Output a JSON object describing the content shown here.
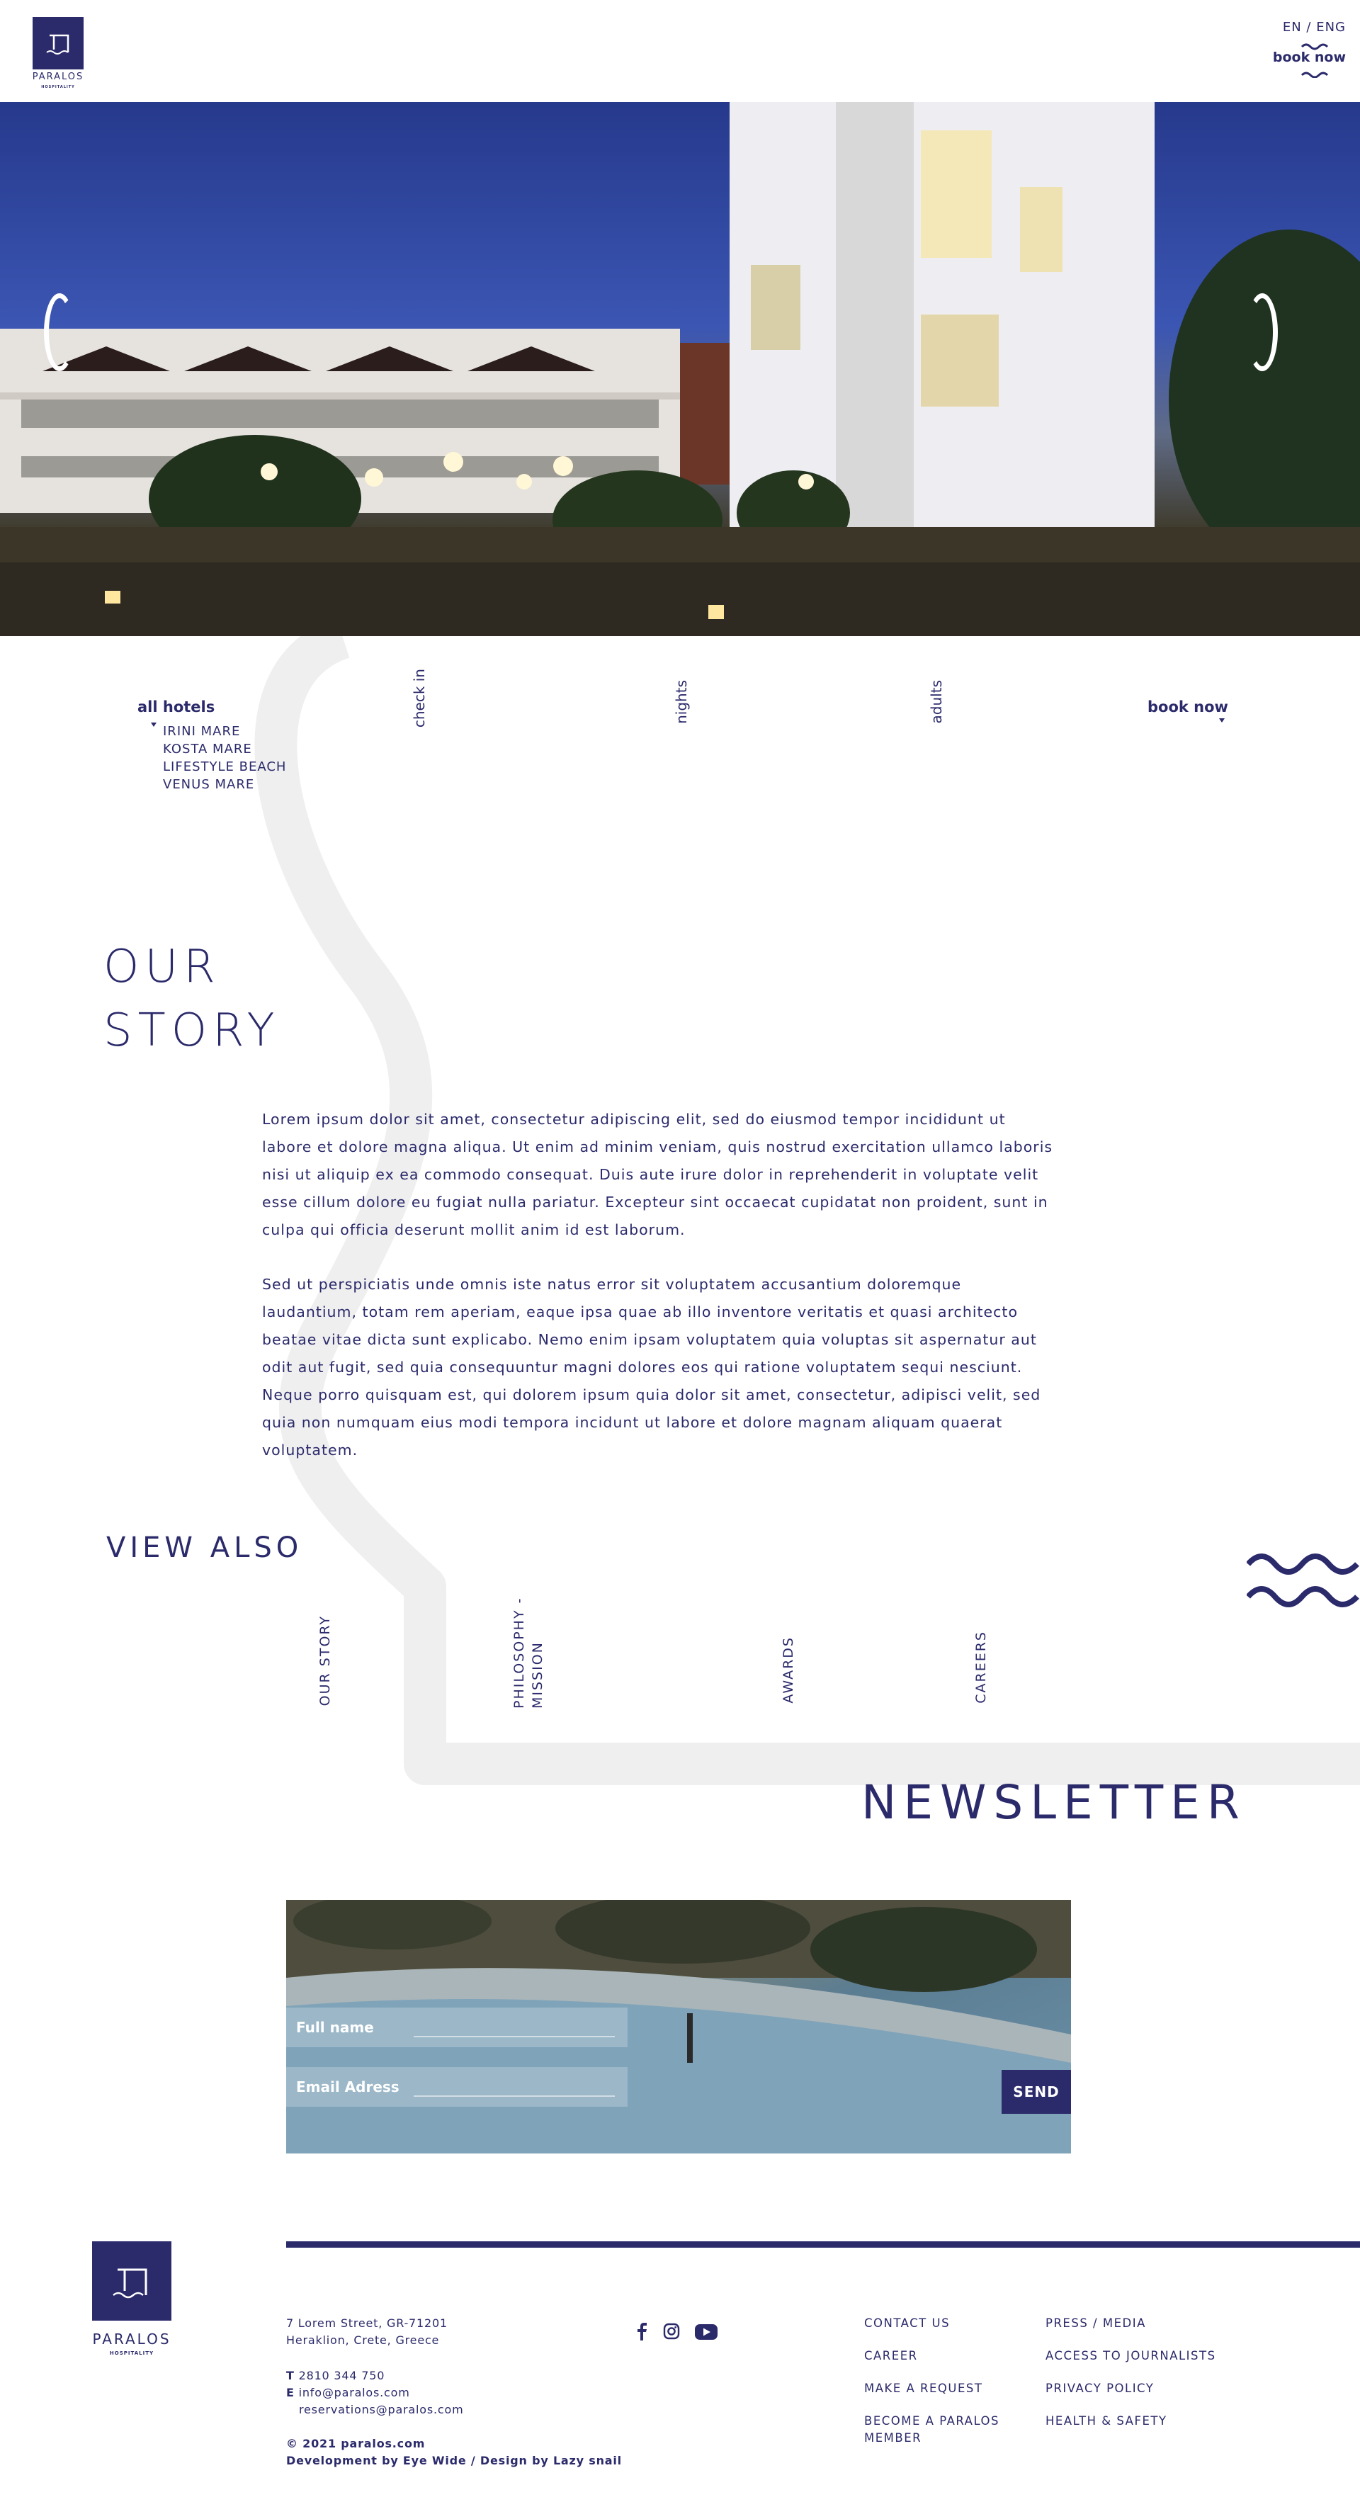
{
  "header": {
    "brand_name": "PARALOS",
    "brand_sub": "HOSPITALITY",
    "language": "EN / ENG",
    "book_now": "book now"
  },
  "hero": {
    "prev_icon": "bracket-left-icon",
    "next_icon": "bracket-right-icon"
  },
  "booking_bar": {
    "hotels_label": "all hotels",
    "hotels": [
      "IRINI MARE",
      "KOSTA MARE",
      "LIFESTYLE BEACH",
      "VENUS MARE"
    ],
    "check_in": "check in",
    "nights": "nights",
    "adults": "adults",
    "book_now": "book now"
  },
  "story": {
    "title_line1": "OUR",
    "title_line2": "STORY",
    "paragraph1_lines": [
      "Lorem ipsum dolor sit amet, consectetur adipiscing elit, sed do eiusmod tempor incididunt ut",
      "labore et dolore magna aliqua. Ut enim ad minim veniam, quis nostrud exercitation ullamco laboris",
      "nisi ut aliquip ex ea commodo consequat. Duis aute irure dolor in reprehenderit in voluptate velit",
      "esse cillum dolore eu fugiat nulla pariatur. Excepteur sint occaecat cupidatat non proident, sunt in",
      "culpa qui officia deserunt mollit anim id est laborum."
    ],
    "paragraph2_lines": [
      "Sed ut perspiciatis unde omnis iste natus error sit voluptatem accusantium doloremque",
      "laudantium, totam rem aperiam, eaque ipsa quae ab illo inventore veritatis et quasi architecto",
      "beatae vitae dicta sunt explicabo. Nemo enim ipsam voluptatem quia voluptas sit aspernatur aut",
      "odit aut fugit, sed quia consequuntur magni dolores eos qui ratione voluptatem sequi nesciunt.",
      "Neque porro quisquam est, qui dolorem ipsum quia dolor sit amet, consectetur, adipisci velit, sed",
      "quia non numquam eius modi tempora incidunt ut labore et dolore magnam aliquam quaerat",
      "voluptatem."
    ]
  },
  "view_also": {
    "title": "VIEW ALSO",
    "links": [
      "OUR STORY",
      "PHILOSOPHY - MISSION",
      "AWARDS",
      "CAREERS"
    ]
  },
  "newsletter": {
    "title": "NEWSLETTER",
    "full_name_label": "Full name",
    "email_label": "Email Adress",
    "send_label": "SEND"
  },
  "footer": {
    "brand_name": "PARALOS",
    "brand_sub": "HOSPITALITY",
    "address_line1": "7 Lorem Street, GR-71201",
    "address_line2": "Heraklion, Crete, Greece",
    "phone_prefix": "T",
    "phone": "2810 344 750",
    "email_prefix": "E",
    "email1": "info@paralos.com",
    "email2": "reservations@paralos.com",
    "copyright": "© 2021 paralos.com",
    "credits": "Development by Eye Wide / Design by Lazy snail",
    "social_icons": [
      "facebook-icon",
      "instagram-icon",
      "youtube-icon"
    ],
    "links_col1": [
      "CONTACT US",
      "CAREER",
      "MAKE A REQUEST",
      "BECOME A PARALOS",
      "MEMBER"
    ],
    "links_col2": [
      "PRESS / MEDIA",
      "ACCESS TO JOURNALISTS",
      "PRIVACY POLICY",
      "HEALTH & SAFETY"
    ]
  },
  "colors": {
    "brand_navy": "#2b2a6b",
    "decor_gray": "#efefef",
    "sky_blue": "#2f46a3"
  }
}
